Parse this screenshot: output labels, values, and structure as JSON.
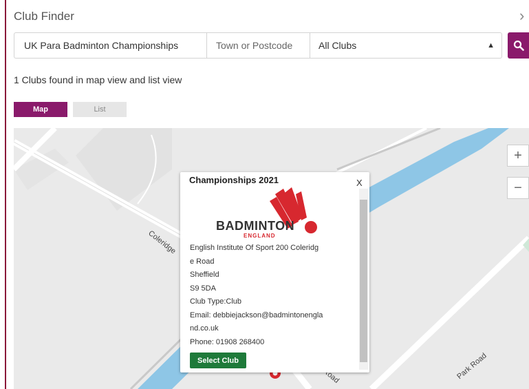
{
  "header": {
    "title": "Club Finder",
    "chevron_glyph": "›"
  },
  "search": {
    "club_value": "UK Para Badminton Championships",
    "location_placeholder": "Town or Postcode",
    "filter_value": "All Clubs",
    "filter_options": [
      "All Clubs"
    ],
    "button_icon": "search-icon"
  },
  "results": {
    "summary": "1 Clubs found in map view and list view"
  },
  "view_tabs": {
    "map_label": "Map",
    "list_label": "List"
  },
  "map": {
    "road_labels": [
      "Coleridge",
      "Road",
      "Park Road"
    ],
    "zoom_in": "+",
    "zoom_out": "−",
    "marker_icon": "map-pin-icon"
  },
  "popup": {
    "title": "Championships 2021",
    "close_label": "X",
    "logo_word": "BADMINTON",
    "logo_sub": "ENGLAND",
    "address_line_1": "English Institute Of Sport 200 Coleridg",
    "address_line_2": "e Road",
    "city": "Sheffield",
    "postcode": "S9 5DA",
    "club_type": "Club Type:Club",
    "email_line_1": "Email: debbiejackson@badmintonengla",
    "email_line_2": "nd.co.uk",
    "phone": "Phone: 01908 268400",
    "select_label": "Select Club"
  },
  "colors": {
    "brand_purple": "#8a1a6b",
    "select_green": "#1e7a3a",
    "river_blue": "#8ec6e6",
    "logo_red": "#d7282f"
  }
}
